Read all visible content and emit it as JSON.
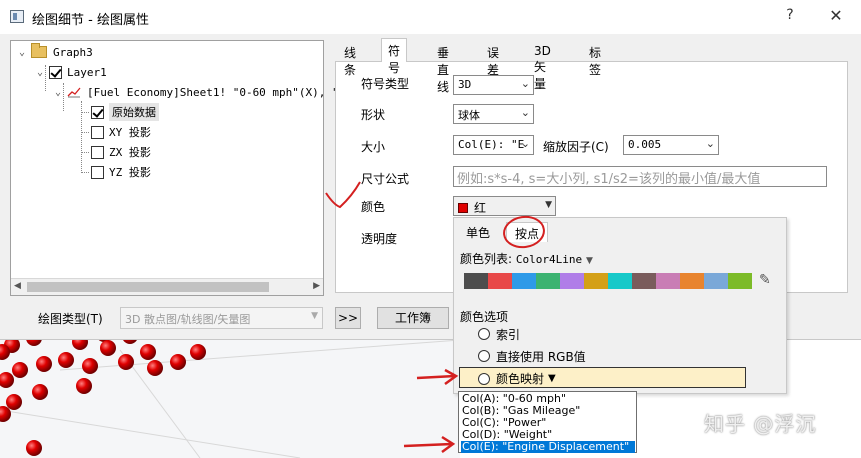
{
  "window": {
    "title": "绘图细节 - 绘图属性",
    "help": "?",
    "close": "✕"
  },
  "tree": {
    "items": [
      {
        "label": "Graph3",
        "checked": null
      },
      {
        "label": "Layer1",
        "checked": true
      },
      {
        "label": "[Fuel Economy]Sheet1! \"0-60 mph\"(X), \"G",
        "checked": null
      },
      {
        "label": "原始数据",
        "checked": true
      },
      {
        "label": "XY 投影",
        "checked": false
      },
      {
        "label": "ZX 投影",
        "checked": false
      },
      {
        "label": "YZ 投影",
        "checked": false
      }
    ]
  },
  "bottom": {
    "plot_type_label": "绘图类型(T)",
    "plot_type_value": "3D 散点图/轨线图/矢量图",
    "expand_label": ">>",
    "workbook_label": "工作簿"
  },
  "tabs": [
    "线条",
    "符号",
    "垂直线",
    "误差棒",
    "3D 矢量",
    "标签"
  ],
  "active_tab": "符号",
  "symbol": {
    "type_label": "符号类型",
    "type_value": "3D",
    "shape_label": "形状",
    "shape_value": "球体",
    "size_label": "大小",
    "size_value": "Col(E): \"E",
    "scale_label": "缩放因子(C)",
    "scale_value": "0.005",
    "formula_label": "尺寸公式",
    "formula_placeholder": "例如:s*s-4, s=大小列, s1/s2=该列的最小值/最大值",
    "color_label": "颜色",
    "color_value": "红",
    "color_hex": "#e00000",
    "transparency_label": "透明度"
  },
  "popup": {
    "tabs": [
      "单色",
      "按点"
    ],
    "active_tab": "按点",
    "colorlist_label": "颜色列表:",
    "colorlist_value": "Color4Line",
    "palette": [
      "#4d4d4d",
      "#e84848",
      "#2e9ae8",
      "#3cb371",
      "#b07de8",
      "#d4a017",
      "#17c9c9",
      "#7a5c5c",
      "#c97db5",
      "#e8842e",
      "#7aa8d8",
      "#7cbb28"
    ],
    "options_label": "颜色选项",
    "option_index": "索引",
    "option_rgb": "直接使用 RGB值",
    "option_colormap": "颜色映射"
  },
  "dropdown": {
    "items": [
      "Col(A): \"0-60 mph\"",
      "Col(B): \"Gas Mileage\"",
      "Col(C): \"Power\"",
      "Col(D): \"Weight\"",
      "Col(E): \"Engine Displacement\""
    ],
    "selected_index": 4
  },
  "colors": {
    "annotation": "#d42020",
    "selection": "#0078d7",
    "highlight": "#fdf0c8"
  },
  "watermark": "知乎 @浮沉"
}
